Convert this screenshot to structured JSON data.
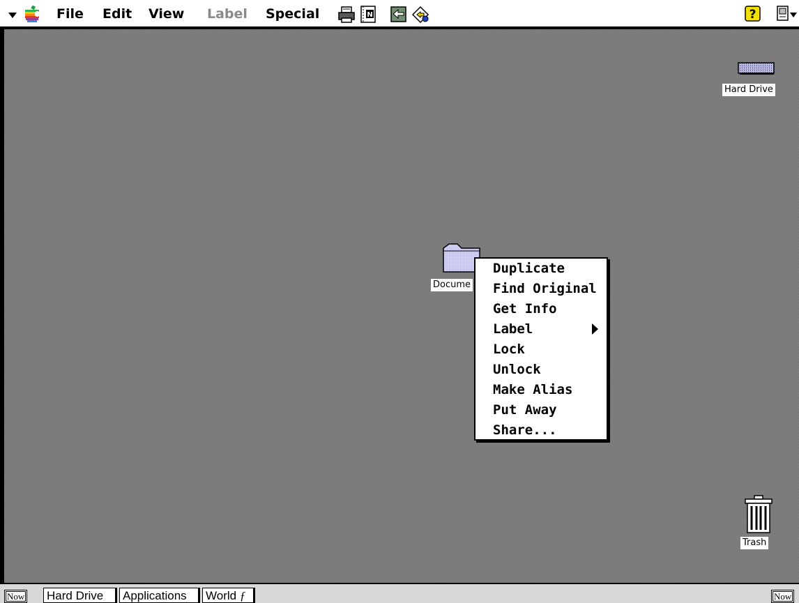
{
  "menubar": {
    "items": [
      {
        "label": "File",
        "enabled": true
      },
      {
        "label": "Edit",
        "enabled": true
      },
      {
        "label": "View",
        "enabled": true
      },
      {
        "label": "Label",
        "enabled": false
      },
      {
        "label": "Special",
        "enabled": true
      }
    ],
    "toolbar_icons": [
      "printer-icon",
      "notepad-icon",
      "back-arrow-icon",
      "diamond-arrow-icon"
    ],
    "right_icons": [
      "help-icon",
      "application-switcher-icon"
    ]
  },
  "desktop": {
    "hard_drive": {
      "label": "Hard Drive"
    },
    "document_folder": {
      "label": "Documents",
      "visible_label": "Docume"
    },
    "trash": {
      "label": "Trash"
    }
  },
  "context_menu": {
    "items": [
      {
        "label": "Duplicate"
      },
      {
        "label": "Find Original"
      },
      {
        "label": "Get Info"
      },
      {
        "label": "Label",
        "submenu": true
      },
      {
        "label": "Lock"
      },
      {
        "label": "Unlock"
      },
      {
        "label": "Make Alias"
      },
      {
        "label": "Put Away"
      },
      {
        "label": "Share..."
      }
    ]
  },
  "taskbar": {
    "left_now": "Now",
    "right_now": "Now",
    "buttons": [
      {
        "label": "Hard Drive"
      },
      {
        "label": "Applications"
      },
      {
        "label": "World",
        "suffix": "ƒ"
      }
    ]
  },
  "colors": {
    "desktop": "#7e7e7e",
    "menubar": "#ffffff",
    "taskbar": "#d8d8d8",
    "folder": "#cfcfee"
  }
}
